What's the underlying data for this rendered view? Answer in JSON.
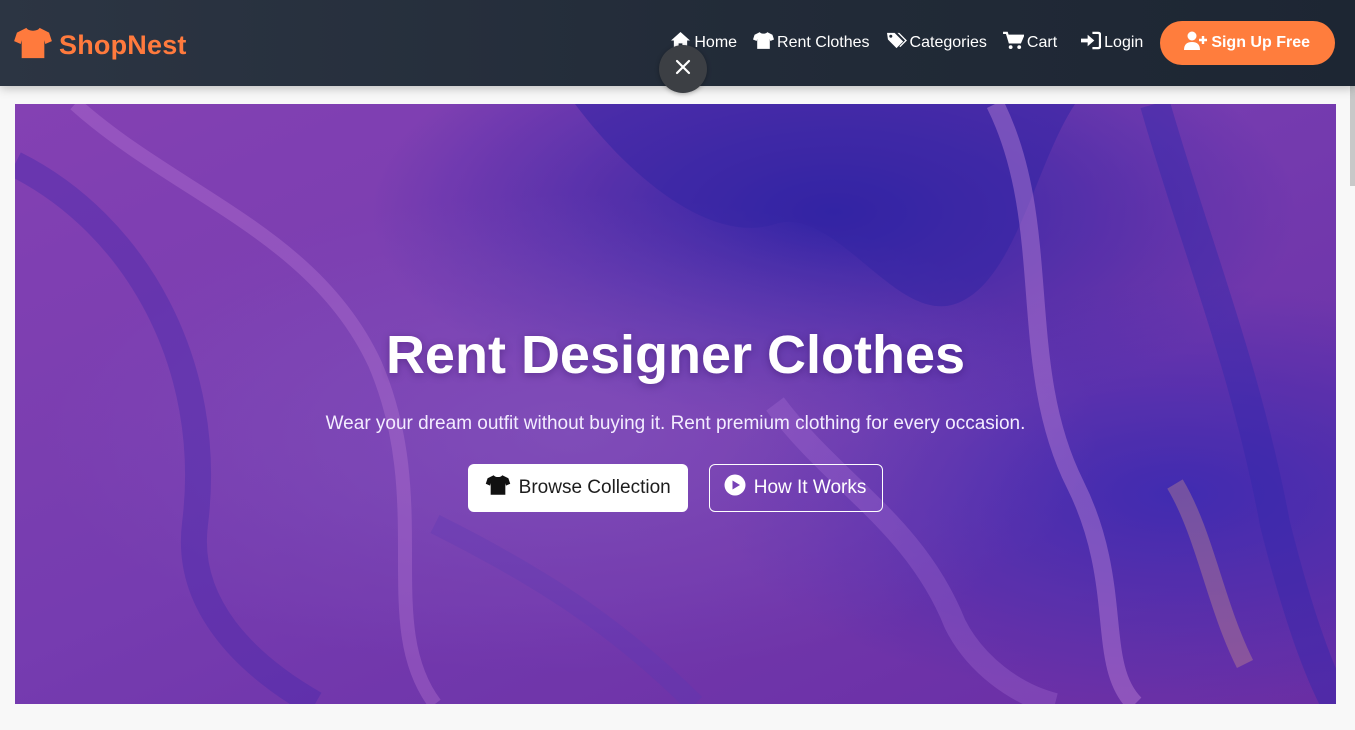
{
  "brand": {
    "name": "ShopNest",
    "icon": "shirt-icon",
    "color": "#ff7a3d"
  },
  "nav": {
    "links": [
      {
        "label": "Home",
        "icon": "home-icon"
      },
      {
        "label": "Rent Clothes",
        "icon": "shirt-icon"
      },
      {
        "label": "Categories",
        "icon": "tags-icon"
      },
      {
        "label": "Cart",
        "icon": "cart-icon"
      },
      {
        "label": "Login",
        "icon": "sign-in-icon"
      }
    ],
    "signup": {
      "label": "Sign Up Free",
      "icon": "user-plus-icon",
      "color": "#ff7d3d"
    }
  },
  "overlay": {
    "close_icon": "close-icon"
  },
  "hero": {
    "title": "Rent Designer Clothes",
    "subtitle": "Wear your dream outfit without buying it. Rent premium clothing for every occasion.",
    "primary_button": {
      "label": "Browse Collection",
      "icon": "shirt-icon"
    },
    "secondary_button": {
      "label": "How It Works",
      "icon": "play-circle-icon"
    }
  },
  "colors": {
    "navbar": "#232c39",
    "accent": "#ff7d3d",
    "hero_purple": "#7c43b8",
    "hero_indigo": "#3a2fb0"
  }
}
